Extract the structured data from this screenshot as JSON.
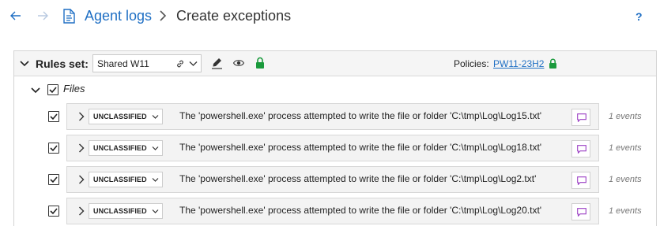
{
  "header": {
    "breadcrumb_link": "Agent logs",
    "breadcrumb_current": "Create exceptions",
    "help_label": "?"
  },
  "rules_set": {
    "label": "Rules set:",
    "selected": "Shared W11",
    "policies_label": "Policies:",
    "policy": "PW11-23H2",
    "lock_color": "#1a9a3c"
  },
  "group": {
    "label": "Files",
    "checked": true
  },
  "exceptions": [
    {
      "classification": "UNCLASSIFIED",
      "description": "The 'powershell.exe' process attempted to write the file or folder 'C:\\tmp\\Log\\Log15.txt'",
      "events": "1 events",
      "checked": true
    },
    {
      "classification": "UNCLASSIFIED",
      "description": "The 'powershell.exe' process attempted to write the file or folder 'C:\\tmp\\Log\\Log18.txt'",
      "events": "1 events",
      "checked": true
    },
    {
      "classification": "UNCLASSIFIED",
      "description": "The 'powershell.exe' process attempted to write the file or folder 'C:\\tmp\\Log\\Log2.txt'",
      "events": "1 events",
      "checked": true
    },
    {
      "classification": "UNCLASSIFIED",
      "description": "The 'powershell.exe' process attempted to write the file or folder 'C:\\tmp\\Log\\Log20.txt'",
      "events": "1 events",
      "checked": true
    }
  ],
  "colors": {
    "link": "#1f6fc4",
    "comment_icon": "#9b3fc4"
  }
}
